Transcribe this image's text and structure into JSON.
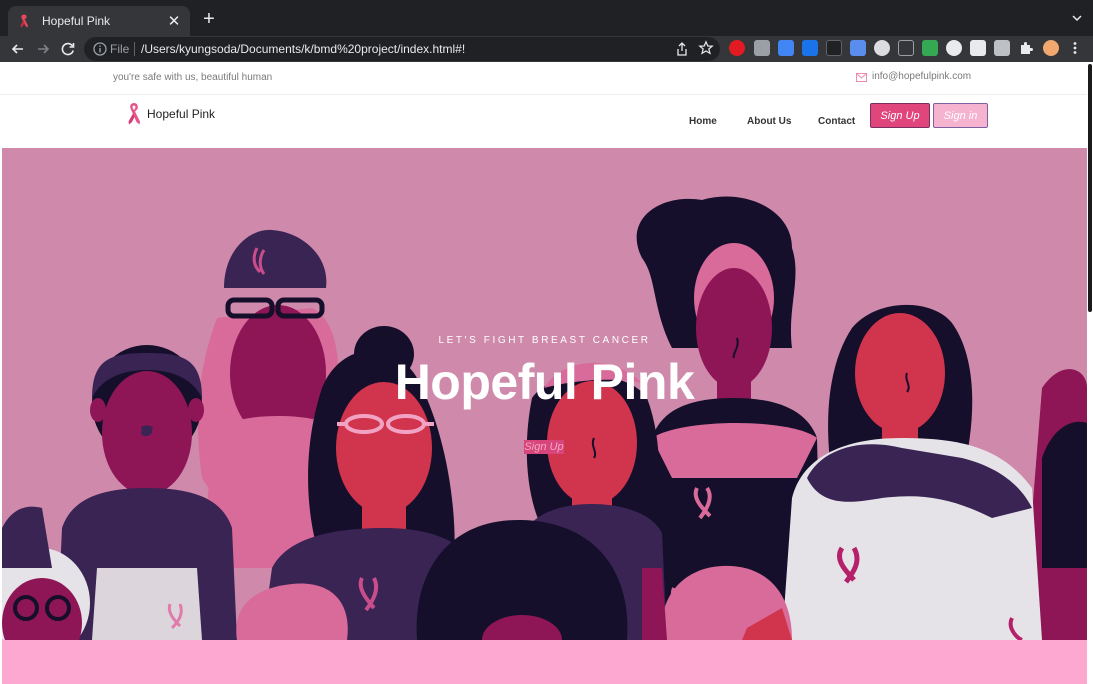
{
  "browser": {
    "tab": {
      "title": "Hopeful Pink",
      "favicon": "pink-ribbon-icon"
    },
    "omnibox": {
      "scheme_label": "File",
      "url": "/Users/kyungsoda/Documents/k/bmd%20project/index.html#!"
    }
  },
  "topbar": {
    "tagline": "you're safe with us, beautiful human",
    "email": "info@hopefulpink.com"
  },
  "header": {
    "logo_text": "Hopeful Pink",
    "nav": {
      "home": "Home",
      "about": "About Us",
      "contact": "Contact"
    },
    "signup_label": "Sign Up",
    "signin_label": "Sign in"
  },
  "hero": {
    "subtitle": "LET'S FIGHT BREAST CANCER",
    "title": "Hopeful Pink",
    "button_label": "Sign Up"
  },
  "colors": {
    "brand_pink": "#e0457b",
    "hero_background": "#cf8aab",
    "footer_band": "#fda8d0",
    "dark_navy": "#150f2b",
    "magenta": "#8e1656",
    "red": "#d1344d",
    "purple": "#392454"
  }
}
